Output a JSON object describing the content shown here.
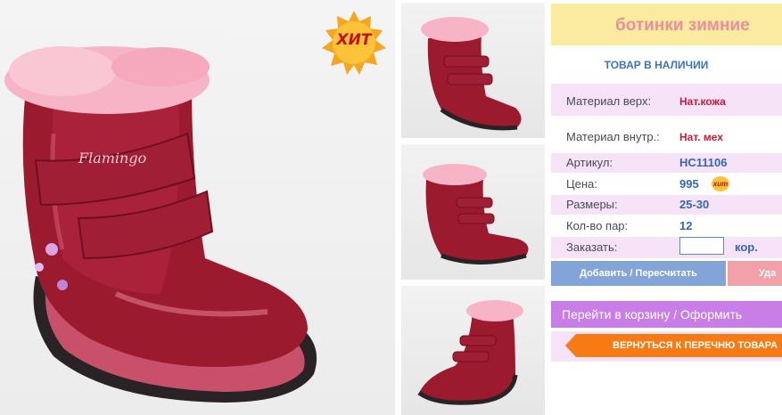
{
  "product": {
    "title": "ботинки зимние",
    "stock_status": "ТОВАР В НАЛИЧИИ",
    "badge": "ХИТ"
  },
  "specs": [
    {
      "label": "Материал верх:",
      "value": "Нат.кожа"
    },
    {
      "label": "Материал внутр.:",
      "value": "Нат. мех"
    },
    {
      "label": "Артикул:",
      "value": "НС11106"
    },
    {
      "label": "Цена:",
      "value": "995"
    },
    {
      "label": "Размеры:",
      "value": "25-30"
    },
    {
      "label": "Кол-во пар:",
      "value": "12"
    }
  ],
  "price_badge": "хит",
  "order": {
    "label": "Заказать:",
    "quantity": "",
    "unit": "кор."
  },
  "buttons": {
    "add": "Добавить / Пересчитать",
    "delete": "Уда",
    "cart": "Перейти в корзину / Оформить",
    "back": "ВЕРНУТЬСЯ К ПЕРЕЧНЮ ТОВАРА"
  },
  "boot_logo": "Flamingo",
  "colors": {
    "title_bg": "#fbeba0",
    "title_text": "#ee8e9a",
    "accent_blue": "#3566b5",
    "row_pink": "#f6e3f7",
    "add_button": "#83a4d8",
    "cart_button": "#c97de6",
    "back_button": "#f77a12"
  }
}
